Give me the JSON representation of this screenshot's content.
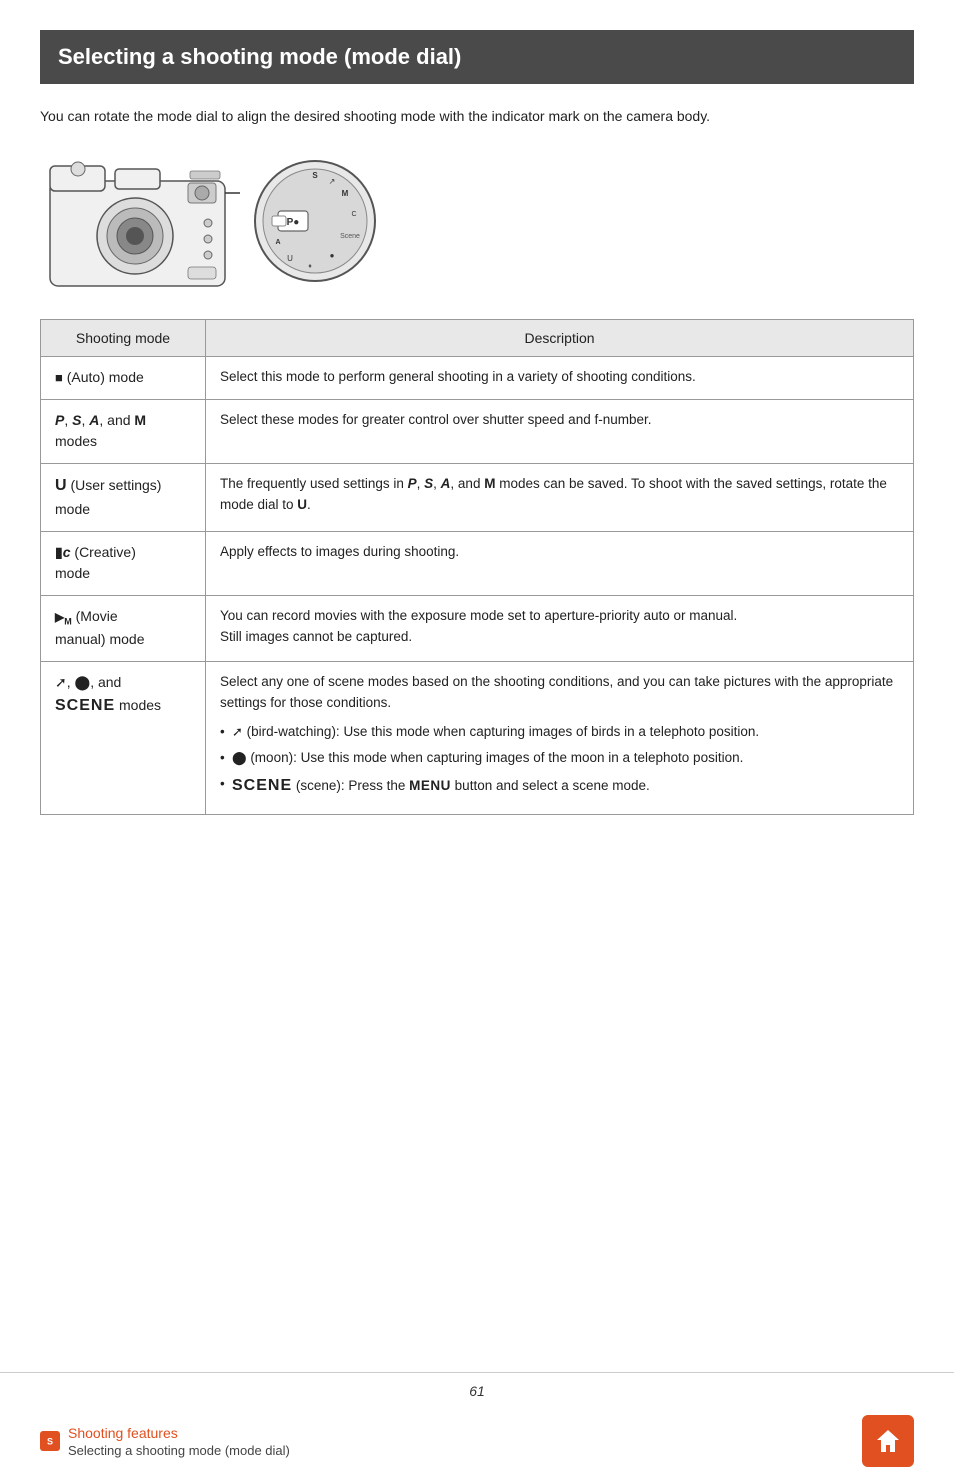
{
  "page": {
    "title": "Selecting a shooting mode (mode dial)",
    "intro": "You can rotate the mode dial to align the desired shooting mode with the indicator mark on the camera body.",
    "page_number": "61"
  },
  "table": {
    "header_mode": "Shooting mode",
    "header_desc": "Description",
    "rows": [
      {
        "id": "auto",
        "mode_label": "(Auto) mode",
        "mode_icon": "auto",
        "description": "Select this mode to perform general shooting in a variety of shooting conditions."
      },
      {
        "id": "psam",
        "mode_label": "modes",
        "mode_prefix": "P, S, A, and M",
        "description": "Select these modes for greater control over shutter speed and f-number."
      },
      {
        "id": "user",
        "mode_label": "(User settings) mode",
        "mode_prefix": "U",
        "description": "The frequently used settings in P, S, A, and M modes can be saved. To shoot with the saved settings, rotate the mode dial to U."
      },
      {
        "id": "creative",
        "mode_label": "(Creative) mode",
        "mode_icon": "creative",
        "description": "Apply effects to images during shooting."
      },
      {
        "id": "movie",
        "mode_label": "(Movie manual) mode",
        "mode_icon": "movie",
        "description": "You can record movies with the exposure mode set to aperture-priority auto or manual.\nStill images cannot be captured."
      },
      {
        "id": "scene",
        "mode_label": ", and SCENE modes",
        "mode_icon": "scene",
        "description_main": "Select any one of scene modes based on the shooting conditions, and you can take pictures with the appropriate settings for those conditions.",
        "bullets": [
          "(bird-watching): Use this mode when capturing images of birds in a telephoto position.",
          "(moon): Use this mode when capturing images of the moon in a telephoto position.",
          "SCENE (scene): Press the MENU button and select a scene mode."
        ]
      }
    ]
  },
  "footer": {
    "section_label": "Shooting features",
    "breadcrumb": "Selecting a shooting mode (mode dial)",
    "home_title": "Home"
  }
}
